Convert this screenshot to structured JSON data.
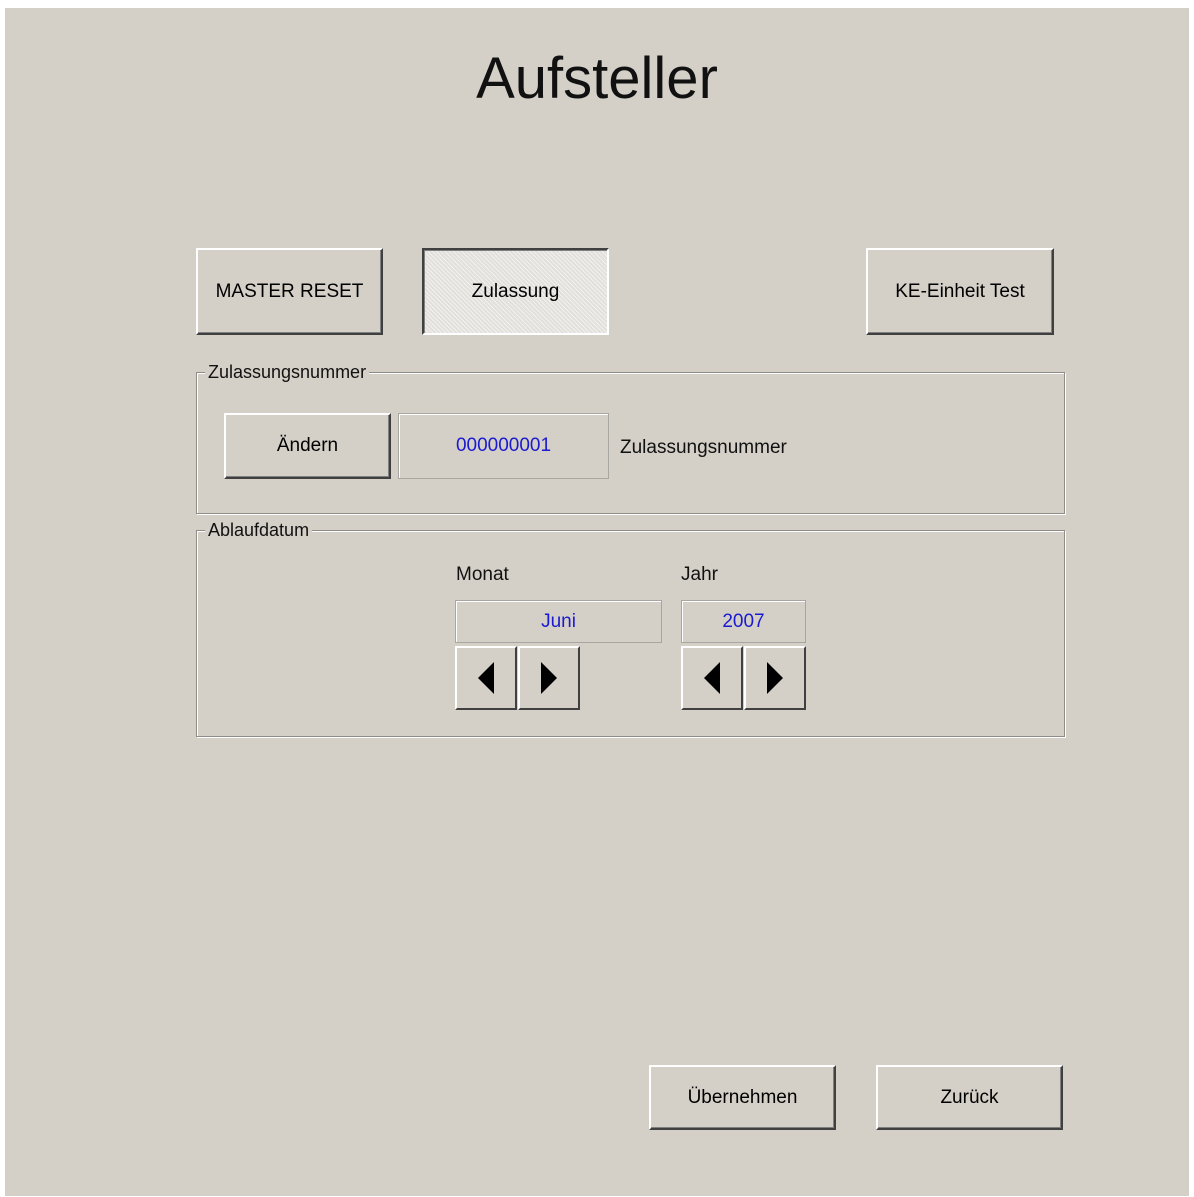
{
  "title": "Aufsteller",
  "top_buttons": {
    "master_reset": "MASTER RESET",
    "zulassung": "Zulassung",
    "ke_test": "KE-Einheit Test"
  },
  "zulassung_group": {
    "legend": "Zulassungsnummer",
    "change_button": "Ändern",
    "number_value": "000000001",
    "number_label": "Zulassungsnummer"
  },
  "ablauf_group": {
    "legend": "Ablaufdatum",
    "month_label": "Monat",
    "month_value": "Juni",
    "year_label": "Jahr",
    "year_value": "2007"
  },
  "bottom_buttons": {
    "apply": "Übernehmen",
    "back": "Zurück"
  },
  "colors": {
    "background": "#d4d0c8",
    "value_text": "#1a1ad0"
  },
  "icons": {
    "prev": "triangle-left-icon",
    "next": "triangle-right-icon"
  }
}
